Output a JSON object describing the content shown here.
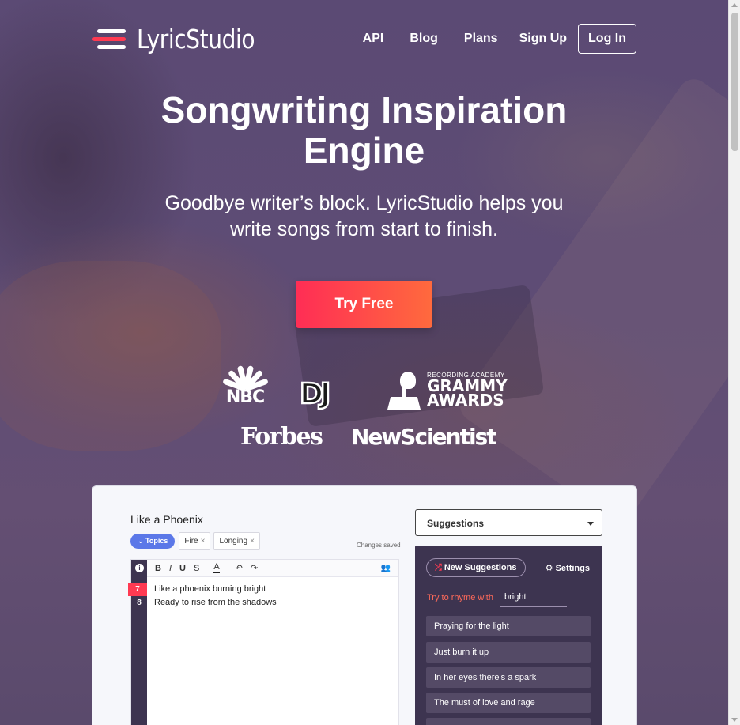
{
  "brand": {
    "name": "LyricStudio"
  },
  "nav": {
    "links": [
      "API",
      "Blog",
      "Plans",
      "Sign Up"
    ],
    "login": "Log In"
  },
  "hero": {
    "title_line1": "Songwriting Inspiration",
    "title_line2": "Engine",
    "subtitle_line1": "Goodbye writer’s block. LyricStudio helps you",
    "subtitle_line2": "write songs from start to finish.",
    "cta": "Try Free"
  },
  "press": {
    "nbc": "NBC",
    "dj": "DJ",
    "grammy_small": "RECORDING ACADEMY",
    "grammy_line1": "GRAMMY",
    "grammy_line2": "AWARDS",
    "forbes": "Forbes",
    "newscientist": "NewScientist"
  },
  "app": {
    "doc_title": "Like a Phoenix",
    "topics_label": "Topics",
    "tags": [
      "Fire",
      "Longing"
    ],
    "saved_status": "Changes saved",
    "toolbar": [
      "B",
      "I",
      "U",
      "S",
      "A",
      "↶",
      "↷"
    ],
    "line_numbers": [
      "7",
      "8"
    ],
    "lines": [
      "Like a phoenix burning bright",
      "Ready to rise from the shadows"
    ],
    "suggestions_select": "Suggestions",
    "new_suggestions": "New Suggestions",
    "settings": "Settings",
    "rhyme_label": "Try to rhyme with",
    "rhyme_value": "bright",
    "suggestions": [
      "Praying for the light",
      "Just burn it up",
      "In her eyes there's a spark",
      "The must of love and rage"
    ]
  },
  "colors": {
    "accent": "#ff3a52",
    "cta_gradient_start": "#ff2d55",
    "cta_gradient_end": "#ff6a3d",
    "topics_pill": "#5b78e8",
    "panel_dark": "#3d3450"
  }
}
